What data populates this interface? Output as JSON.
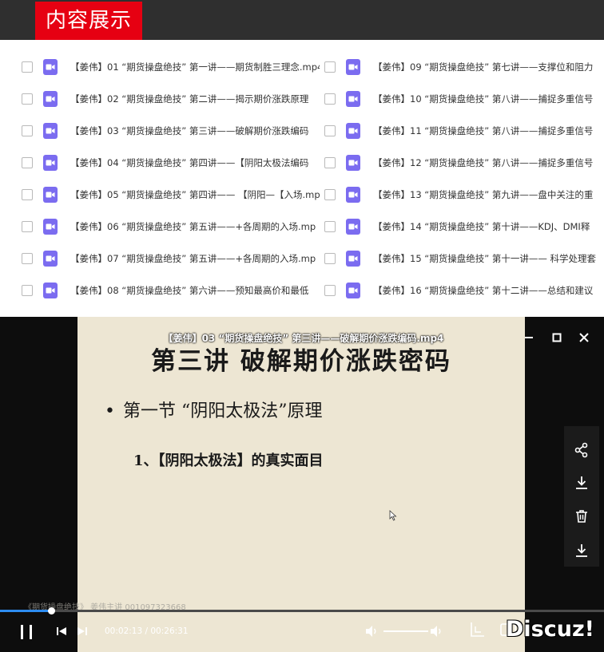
{
  "header": {
    "title": "内容展示"
  },
  "files": [
    "【姜伟】01 “期货操盘绝技” 第一讲——期货制胜三理念.mp4",
    "【姜伟】02 “期货操盘绝技” 第二讲——揭示期价涨跌原理",
    "【姜伟】03 “期货操盘绝技” 第三讲——破解期价涨跌编码",
    "【姜伟】04 “期货操盘绝技” 第四讲——【阴阳太极法编码",
    "【姜伟】05 “期货操盘绝技” 第四讲—— 【阴阳—【入场.mp",
    "【姜伟】06 “期货操盘绝技” 第五讲——+各周期的入场.mp",
    "【姜伟】07 “期货操盘绝技” 第五讲——+各周期的入场.mp",
    "【姜伟】08 “期货操盘绝技” 第六讲——预知最高价和最低",
    "【姜伟】09 “期货操盘绝技” 第七讲——支撑位和阻力",
    "【姜伟】10 “期货操盘绝技” 第八讲——捕捉多重信号",
    "【姜伟】11 “期货操盘绝技” 第八讲——捕捉多重信号",
    "【姜伟】12 “期货操盘绝技” 第八讲——捕捉多重信号",
    "【姜伟】13 “期货操盘绝技” 第九讲——盘中关注的重",
    "【姜伟】14 “期货操盘绝技” 第十讲——KDJ、DMI释",
    "【姜伟】15 “期货操盘绝技” 第十一讲—— 科学处理套",
    "【姜伟】16 “期货操盘绝技” 第十二讲——总结和建议"
  ],
  "player": {
    "video_title": "【姜伟】03 “期货操盘绝技” 第三讲——破解期价涨跌编码.mp4",
    "slide": {
      "title": "第三讲 破解期价涨跌密码",
      "bullet": "第一节 “阴阳太极法”原理",
      "sub_item": "1、【阴阳太极法】的真实面目"
    },
    "watermark": "《期货操盘绝技》 姜伟主讲 001097323668",
    "time_text": "00:02:13 / 00:26:31",
    "progress": 0.084,
    "brand": "Discuz!"
  },
  "colors": {
    "header_bg": "#2f2f2f",
    "title_red": "#e60012",
    "file_icon": "#7b6cf0",
    "progress": "#2d8cf0"
  },
  "icons": {
    "window": [
      "minimize-icon",
      "maximize-icon",
      "close-icon"
    ],
    "side": [
      "share-icon",
      "download-icon",
      "delete-icon",
      "save-icon"
    ],
    "controls": [
      "pause-icon",
      "previous-icon",
      "next-icon",
      "volume-icon",
      "volume-max-icon",
      "screenshot-icon",
      "fullscreen-icon"
    ]
  }
}
